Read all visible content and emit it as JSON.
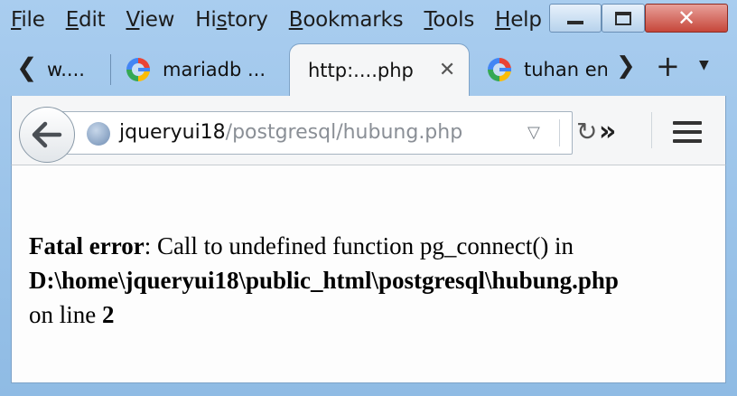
{
  "menu": [
    {
      "prefix": "",
      "underline": "F",
      "rest": "ile"
    },
    {
      "prefix": "",
      "underline": "E",
      "rest": "dit"
    },
    {
      "prefix": "",
      "underline": "V",
      "rest": "iew"
    },
    {
      "prefix": "Hi",
      "underline": "s",
      "rest": "tory"
    },
    {
      "prefix": "",
      "underline": "B",
      "rest": "ookmarks"
    },
    {
      "prefix": "",
      "underline": "T",
      "rest": "ools"
    },
    {
      "prefix": "",
      "underline": "H",
      "rest": "elp"
    }
  ],
  "tabs": {
    "scroll_left": "❮",
    "tab1_label": "w....",
    "tab2_label": "mariadb ...",
    "tab3_label": "http:....php",
    "tab3_close": "✕",
    "tab4_label": "tuhan en",
    "scroll_right": "❯",
    "new_tab": "+",
    "list_all": "▼"
  },
  "navbar": {
    "url_host": "jqueryui18",
    "url_path": "/postgresql/hubung.php",
    "dropdown": "▽",
    "reload": "↻",
    "overflow": "»"
  },
  "content": {
    "error_label": "Fatal error",
    "error_message": ": Call to undefined function pg_connect() in",
    "error_path": "D:\\home\\jqueryui18\\public_html\\postgresql\\hubung.php",
    "line_prefix": "on line ",
    "line_number": "2"
  },
  "colors": {
    "frame": "#a9cdef",
    "close_button": "#c6463a",
    "page_background": "#fdfdfd"
  }
}
